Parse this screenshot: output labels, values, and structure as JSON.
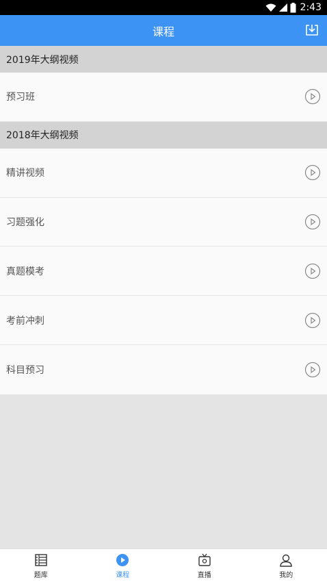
{
  "status_bar": {
    "time": "2:43"
  },
  "header": {
    "title": "课程"
  },
  "sections": [
    {
      "title": "2019年大纲视频",
      "items": [
        {
          "label": "预习班"
        }
      ]
    },
    {
      "title": "2018年大纲视频",
      "items": [
        {
          "label": "精讲视频"
        },
        {
          "label": "习题强化"
        },
        {
          "label": "真题模考"
        },
        {
          "label": "考前冲刺"
        },
        {
          "label": "科目预习"
        }
      ]
    }
  ],
  "tabs": [
    {
      "label": "题库",
      "icon": "question-bank-icon",
      "active": false
    },
    {
      "label": "课程",
      "icon": "play-circle-icon",
      "active": true
    },
    {
      "label": "直播",
      "icon": "live-tv-icon",
      "active": false
    },
    {
      "label": "我的",
      "icon": "user-icon",
      "active": false
    }
  ],
  "colors": {
    "accent": "#3d93f4",
    "section_bg": "#d3d3d3",
    "item_bg": "#fafafa",
    "page_bg": "#e4e4e4"
  }
}
